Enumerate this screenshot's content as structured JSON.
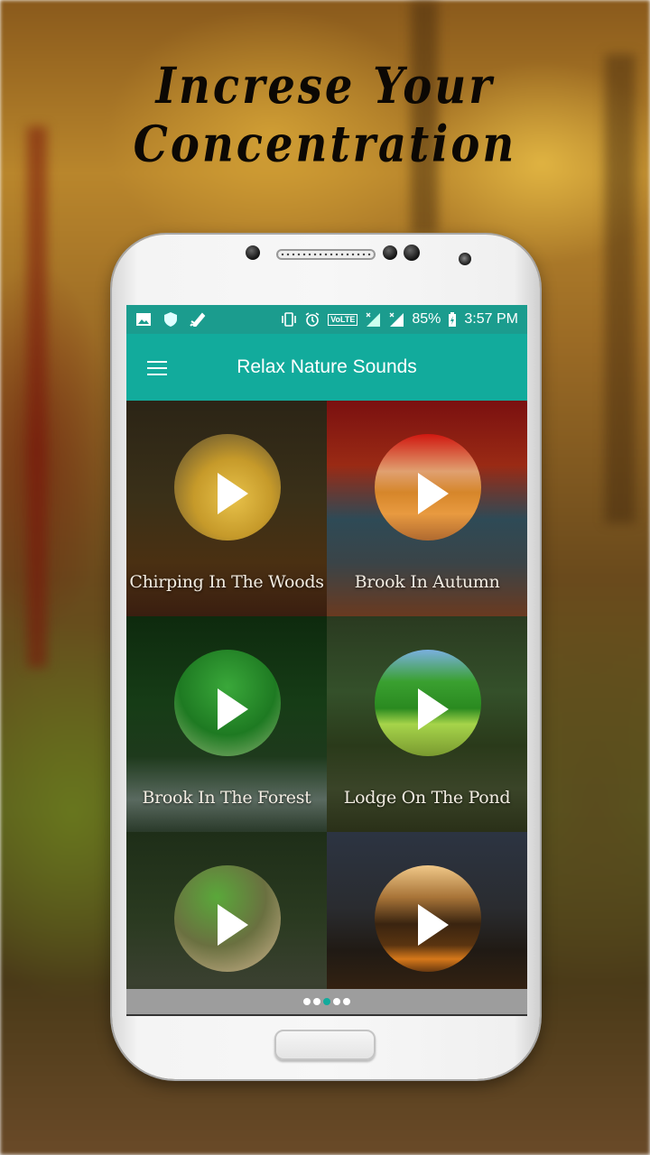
{
  "promo": {
    "headline": "Increse Your Concentration"
  },
  "status_bar": {
    "left_icons": [
      "image-notification-icon",
      "shield-icon",
      "rocket-icon"
    ],
    "right_icons": [
      "vibrate-icon",
      "alarm-icon",
      "volte-icon",
      "signal-x-icon",
      "signal-x-icon"
    ],
    "volte_label": "VoLTE",
    "battery_percent": "85%",
    "time": "3:57 PM"
  },
  "app_bar": {
    "menu_icon": "hamburger-menu-icon",
    "title": "Relax Nature Sounds"
  },
  "sounds": [
    {
      "label": "Chirping In The Woods",
      "icon": "play-icon"
    },
    {
      "label": "Brook In Autumn",
      "icon": "play-icon"
    },
    {
      "label": "Brook In The Forest",
      "icon": "play-icon"
    },
    {
      "label": "Lodge On The Pond",
      "icon": "play-icon"
    },
    {
      "label": "",
      "icon": "play-icon"
    },
    {
      "label": "",
      "icon": "play-icon"
    }
  ],
  "pager": {
    "page_count": 5,
    "active_page": 3
  },
  "colors": {
    "accent": "#12ab9c",
    "status_bar": "#1b9c8e",
    "pager_bg": "#9d9d9d"
  }
}
